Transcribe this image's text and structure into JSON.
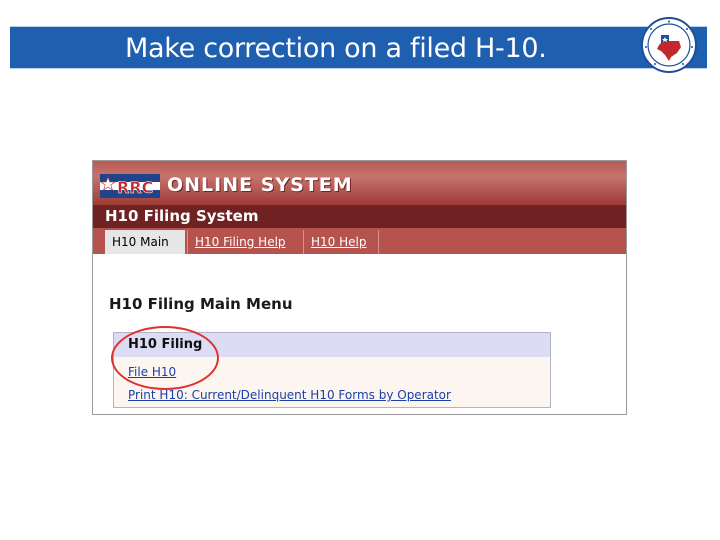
{
  "slide": {
    "title": "Make correction on a filed H-10."
  },
  "colors": {
    "title_bar": "#1f5fb0",
    "header_red": "#b5544f",
    "subheader_red": "#6f2221",
    "menu_header": "#dcdcf5",
    "link": "#1a3fa6",
    "highlight": "#e03030"
  },
  "app": {
    "logo_text": "RRC",
    "banner": "ONLINE SYSTEM",
    "system_title": "H10 Filing System",
    "tabs": [
      {
        "label": "H10 Main",
        "active": true
      },
      {
        "label": "H10 Filing Help",
        "active": false
      },
      {
        "label": "H10 Help",
        "active": false
      }
    ],
    "menu_heading": "H10 Filing Main Menu",
    "menu_box": {
      "title": "H10 Filing",
      "links": [
        {
          "label": "File H10"
        },
        {
          "label": "Print H10: Current/Delinquent H10 Forms by Operator"
        }
      ]
    }
  },
  "icons": {
    "seal": "texas-seal-icon",
    "logo": "rrc-logo-icon"
  }
}
